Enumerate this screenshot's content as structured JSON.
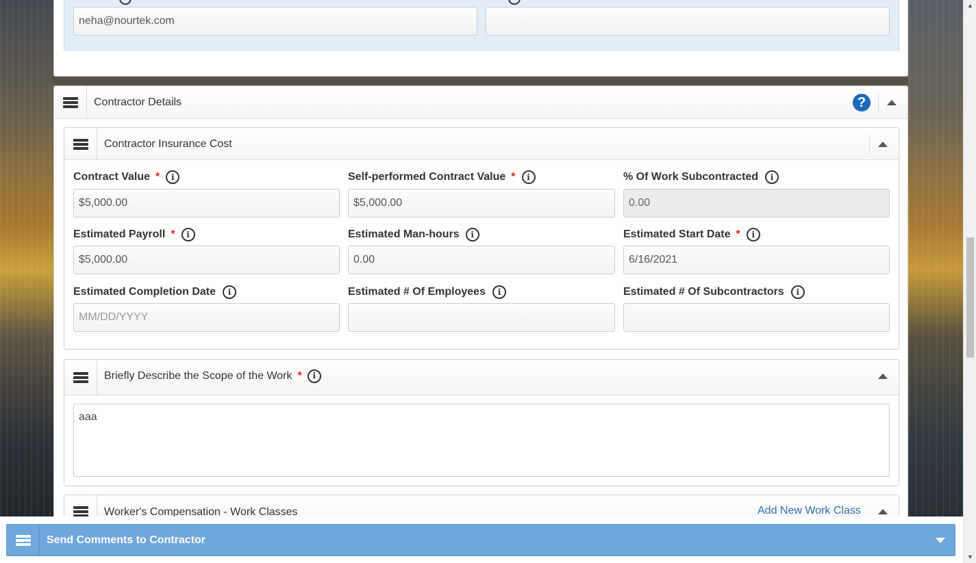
{
  "top_section": {
    "email_value": "neha@nourtek.com",
    "second_value": ""
  },
  "contractor_details": {
    "title": "Contractor Details",
    "help_glyph": "?",
    "insurance": {
      "title": "Contractor Insurance Cost",
      "fields": [
        {
          "label": "Contract Value",
          "required": true,
          "value": "$5,000.00",
          "placeholder": "",
          "readonly": false
        },
        {
          "label": "Self-performed Contract Value",
          "required": true,
          "value": "$5,000.00",
          "placeholder": "",
          "readonly": false
        },
        {
          "label": "% Of Work Subcontracted",
          "required": false,
          "value": "0.00",
          "placeholder": "",
          "readonly": true
        },
        {
          "label": "Estimated Payroll",
          "required": true,
          "value": "$5,000.00",
          "placeholder": "",
          "readonly": false
        },
        {
          "label": "Estimated Man-hours",
          "required": false,
          "value": "0.00",
          "placeholder": "",
          "readonly": false
        },
        {
          "label": "Estimated Start Date",
          "required": true,
          "value": "6/16/2021",
          "placeholder": "",
          "readonly": false
        },
        {
          "label": "Estimated Completion Date",
          "required": false,
          "value": "",
          "placeholder": "MM/DD/YYYY",
          "readonly": false
        },
        {
          "label": "Estimated # Of Employees",
          "required": false,
          "value": "",
          "placeholder": "",
          "readonly": false
        },
        {
          "label": "Estimated # Of Subcontractors",
          "required": false,
          "value": "",
          "placeholder": "",
          "readonly": false
        }
      ]
    },
    "scope": {
      "title": "Briefly Describe the Scope of the Work",
      "required_mark": "*",
      "value": "aaa"
    },
    "work_classes": {
      "title": "Worker's Compensation - Work Classes",
      "add_link": "Add New Work Class"
    }
  },
  "comments": {
    "title": "Send Comments to Contractor"
  },
  "glyphs": {
    "required": "*",
    "info": "i"
  },
  "colors": {
    "accent_blue": "#6fa6dc",
    "help_blue": "#1c6ab6",
    "required_red": "#e02020",
    "link_blue": "#2f6db3"
  }
}
